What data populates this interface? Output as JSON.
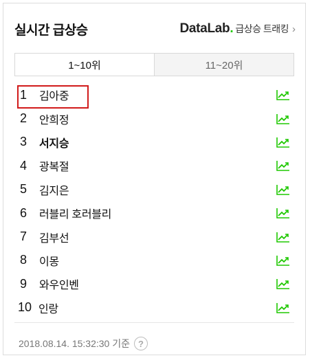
{
  "header": {
    "title": "실시간 급상승",
    "datalab_brand_prefix": "DataLab",
    "datalab_brand_dot": ".",
    "datalab_sub": "급상승 트래킹",
    "chevron": "›"
  },
  "tabs": [
    {
      "label": "1~10위",
      "active": true
    },
    {
      "label": "11~20위",
      "active": false
    }
  ],
  "ranking": [
    {
      "rank": "1",
      "keyword": "김아중",
      "bold": false
    },
    {
      "rank": "2",
      "keyword": "안희정",
      "bold": false
    },
    {
      "rank": "3",
      "keyword": "서지승",
      "bold": true
    },
    {
      "rank": "4",
      "keyword": "광복절",
      "bold": false
    },
    {
      "rank": "5",
      "keyword": "김지은",
      "bold": false
    },
    {
      "rank": "6",
      "keyword": "러블리 호러블리",
      "bold": false
    },
    {
      "rank": "7",
      "keyword": "김부선",
      "bold": false
    },
    {
      "rank": "8",
      "keyword": "이몽",
      "bold": false
    },
    {
      "rank": "9",
      "keyword": "와우인벤",
      "bold": false
    },
    {
      "rank": "10",
      "keyword": "인랑",
      "bold": false
    }
  ],
  "trend_icon": "trend-chart-icon",
  "footer": {
    "timestamp": "2018.08.14. 15:32:30 기준",
    "help": "?"
  },
  "colors": {
    "brand_green": "#1ec800",
    "highlight_red": "#d11a1a"
  }
}
